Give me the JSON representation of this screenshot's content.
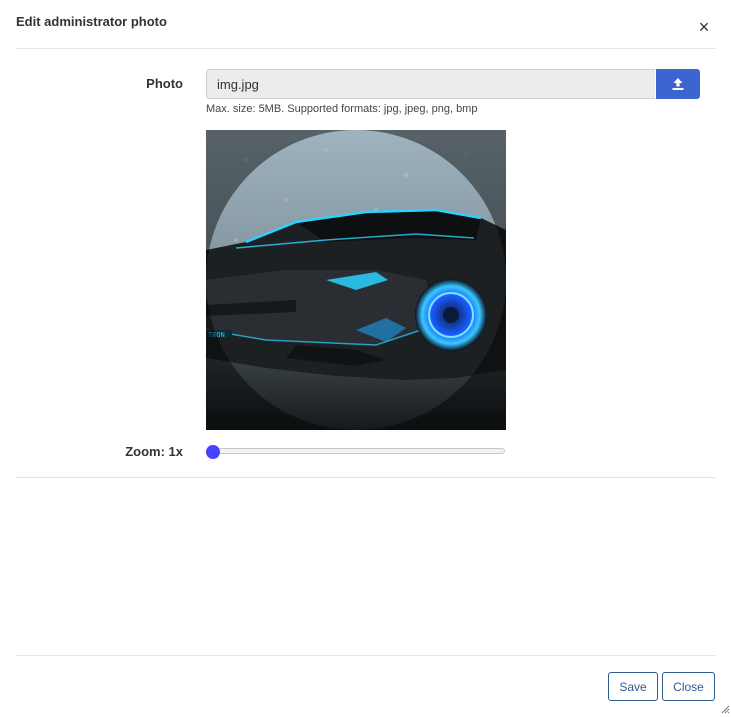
{
  "dialog": {
    "title": "Edit administrator photo",
    "close_glyph": "×"
  },
  "photo": {
    "label": "Photo",
    "file_value": "img.jpg",
    "upload_icon": "upload-icon",
    "hint": "Max. size: 5MB. Supported formats: jpg, jpeg, png, bmp"
  },
  "zoom": {
    "label": "Zoom: 1x",
    "value": 1,
    "min": 1,
    "max": 3,
    "accent": "#4444ff"
  },
  "footer": {
    "save_label": "Save",
    "close_label": "Close"
  },
  "colors": {
    "primary": "#3b66d1",
    "button_border": "#2f5b8f"
  }
}
